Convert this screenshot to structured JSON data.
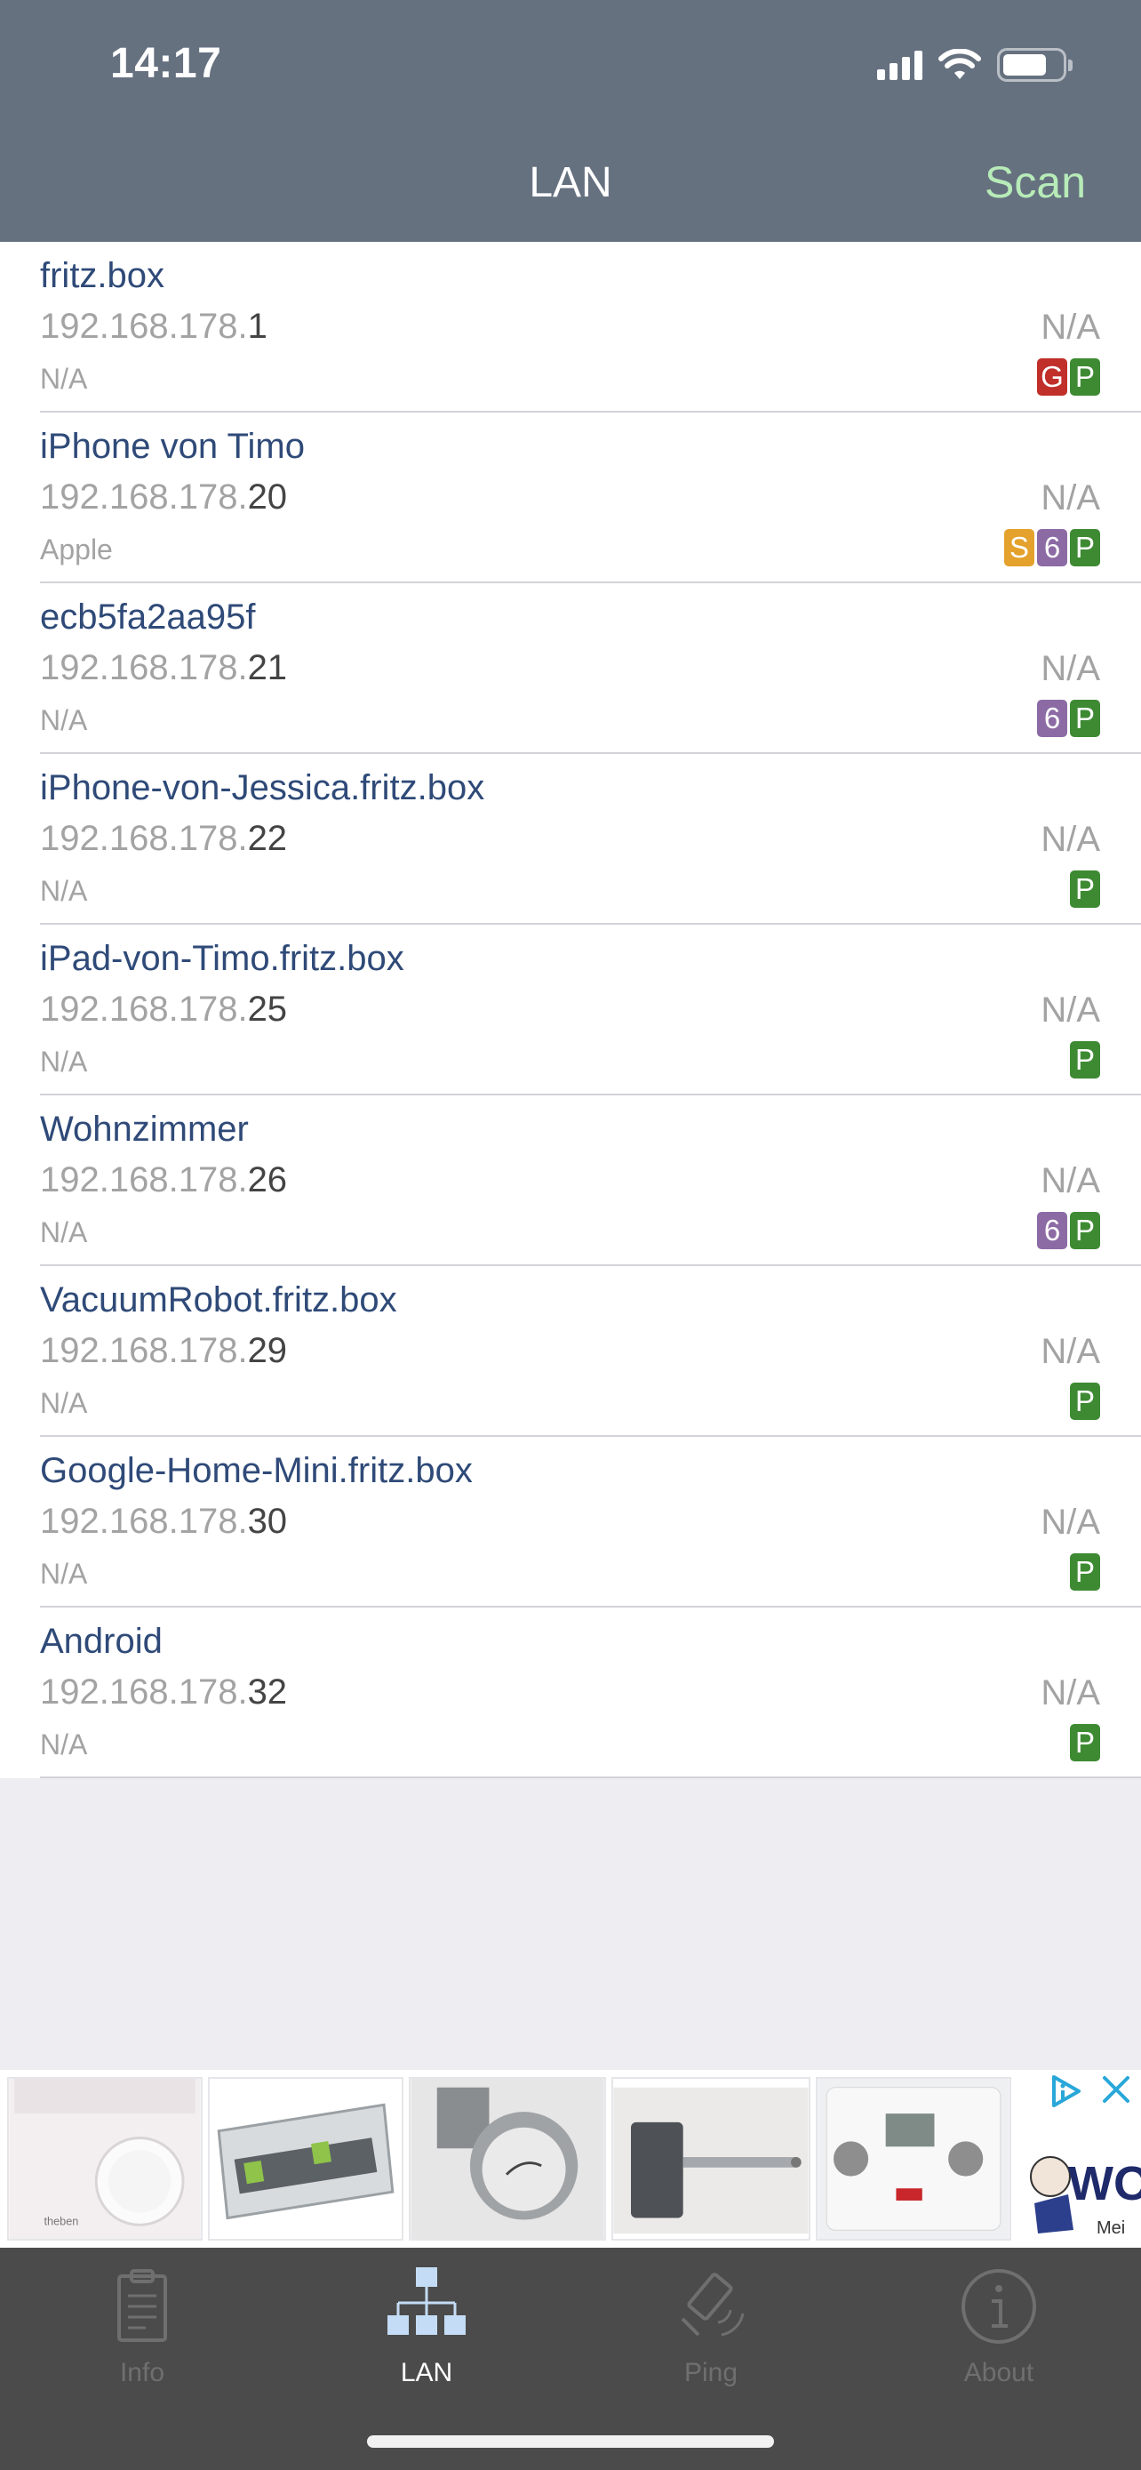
{
  "status_bar": {
    "time": "14:17"
  },
  "nav": {
    "title": "LAN",
    "scan_label": "Scan"
  },
  "devices": [
    {
      "name": "fritz.box",
      "ip_prefix": "192.168.178.",
      "ip_last": "1",
      "vendor": "N/A",
      "latency": "N/A",
      "badges": [
        "G",
        "P"
      ]
    },
    {
      "name": "iPhone von Timo",
      "ip_prefix": "192.168.178.",
      "ip_last": "20",
      "vendor": "Apple",
      "latency": "N/A",
      "badges": [
        "S",
        "6",
        "P"
      ]
    },
    {
      "name": "ecb5fa2aa95f",
      "ip_prefix": "192.168.178.",
      "ip_last": "21",
      "vendor": "N/A",
      "latency": "N/A",
      "badges": [
        "6",
        "P"
      ]
    },
    {
      "name": "iPhone-von-Jessica.fritz.box",
      "ip_prefix": "192.168.178.",
      "ip_last": "22",
      "vendor": "N/A",
      "latency": "N/A",
      "badges": [
        "P"
      ]
    },
    {
      "name": "iPad-von-Timo.fritz.box",
      "ip_prefix": "192.168.178.",
      "ip_last": "25",
      "vendor": "N/A",
      "latency": "N/A",
      "badges": [
        "P"
      ]
    },
    {
      "name": "Wohnzimmer",
      "ip_prefix": "192.168.178.",
      "ip_last": "26",
      "vendor": "N/A",
      "latency": "N/A",
      "badges": [
        "6",
        "P"
      ]
    },
    {
      "name": "VacuumRobot.fritz.box",
      "ip_prefix": "192.168.178.",
      "ip_last": "29",
      "vendor": "N/A",
      "latency": "N/A",
      "badges": [
        "P"
      ]
    },
    {
      "name": "Google-Home-Mini.fritz.box",
      "ip_prefix": "192.168.178.",
      "ip_last": "30",
      "vendor": "N/A",
      "latency": "N/A",
      "badges": [
        "P"
      ]
    },
    {
      "name": "Android",
      "ip_prefix": "192.168.178.",
      "ip_last": "32",
      "vendor": "N/A",
      "latency": "N/A",
      "badges": [
        "P"
      ]
    }
  ],
  "badge_colors": {
    "G": "#c02f2a",
    "P": "#3e8a33",
    "S": "#e4a22c",
    "6": "#8c6ba5"
  },
  "ad": {
    "brand_text": "theben",
    "logo_text": "WO",
    "logo_subtext": "Mei",
    "icons": [
      "ad-choices-icon",
      "close-icon"
    ]
  },
  "tabs": [
    {
      "id": "info",
      "label": "Info",
      "icon": "clipboard-icon",
      "active": false
    },
    {
      "id": "lan",
      "label": "LAN",
      "icon": "network-icon",
      "active": true
    },
    {
      "id": "ping",
      "label": "Ping",
      "icon": "satellite-icon",
      "active": false
    },
    {
      "id": "about",
      "label": "About",
      "icon": "info-circle-icon",
      "active": false
    }
  ],
  "colors": {
    "header_bg": "#667180",
    "scan_accent": "#b7ebb8",
    "device_name": "#2f4a78",
    "tabbar_bg": "#4b4b4b"
  }
}
